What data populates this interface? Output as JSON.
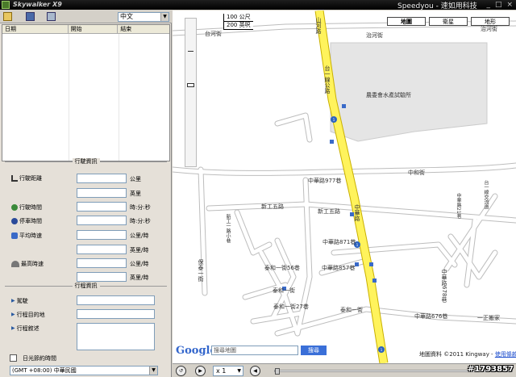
{
  "window": {
    "title": "Skywalker X9",
    "brand": "Speedyou - 速如用科技",
    "controls": [
      "_",
      "□",
      "×"
    ]
  },
  "toolbar": {
    "language": "中文"
  },
  "trip_table": {
    "columns": [
      "日期",
      "開始",
      "結束"
    ]
  },
  "travel_info": {
    "title": "行駛資訊",
    "distance_label": "行駛距離",
    "distance_units": [
      "公里",
      "英里"
    ],
    "travel_time_label": "行駛時間",
    "travel_time_unit": "時:分:秒",
    "stop_time_label": "停車時間",
    "stop_time_unit": "時:分:秒",
    "avg_speed_label": "平均時速",
    "avg_speed_units": [
      "公里/時",
      "英里/時"
    ],
    "max_speed_label": "最高時速",
    "max_speed_units": [
      "公里/時",
      "英里/時"
    ]
  },
  "trip_info": {
    "title": "行程資訊",
    "vehicle_label": "駕駛",
    "destination_label": "行程目的地",
    "description_label": "行程敘述"
  },
  "dst_label": "日光節約時間",
  "timezone": "(GMT +08:00) 中華民國",
  "map": {
    "scale_km": "100 公尺",
    "scale_ft": "200 英呎",
    "type_buttons": [
      "地圖",
      "衛星",
      "地形"
    ],
    "search_placeholder": "搜尋地圖",
    "search_button": "搜尋",
    "google_logo": "Google",
    "copyright": "地圖資料 ©2011 Kingway - ",
    "terms_link": "使用條款",
    "labels": {
      "taihe_st_left": "台河街",
      "taihe_st_right": "治河街",
      "taihe_st_far": "治河街",
      "zhonghe_st": "中和街",
      "zhonghua_977": "中華路977巷",
      "xingong_5": "新工五路",
      "xingong_5b": "新工五路",
      "zhonghua_road": "中華路",
      "zhonghua_871": "中華路871巷",
      "zhonghua_857": "中華路857巷",
      "zhonghua_678": "中華路678巷",
      "zhonghua_676": "中華路676巷",
      "taihe_1st": "泰和一街",
      "taihe_1st_56": "泰和一街56巷",
      "taihe_1st_27": "泰和一街27巷",
      "taihe_1": "泰和一街",
      "baotai_st": "保泰一街",
      "xingong_1st": "新工一路小巷",
      "hsinchu_st": "台一線交流道",
      "zhonghua_road2": "中華路",
      "water_lab": "農委會水產試驗所",
      "fuji": "一正搬家",
      "road_v1": "台一線公路",
      "road_v2": "中華路21巷",
      "mountain": "山河路"
    }
  },
  "playback": {
    "speed": "x 1"
  },
  "watermark": "#1793857"
}
